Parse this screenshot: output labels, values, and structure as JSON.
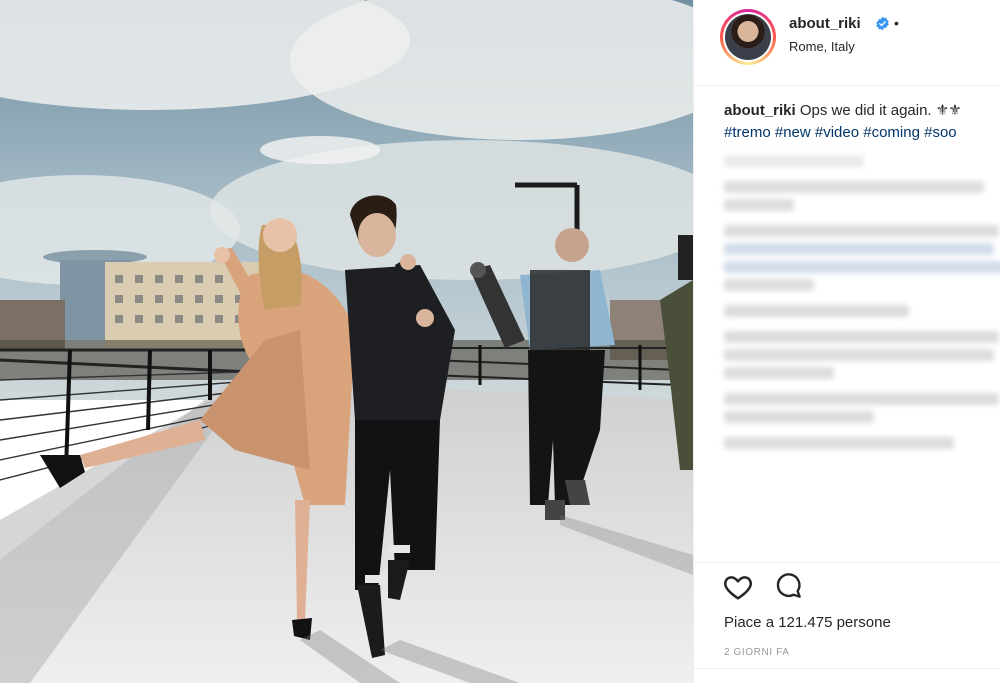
{
  "post": {
    "username": "about_riki",
    "location": "Rome, Italy",
    "separator": "•",
    "caption_text": "Ops we did it again.",
    "caption_emoji": "⚜⚜",
    "hashtags": "#tremo #new #video #coming #soo",
    "load_more": "Carica altri commenti",
    "likes": "Piace a 121.475 persone",
    "time": "2 GIORNI FA"
  },
  "icons": {
    "verified": "verified-badge-icon",
    "like": "heart-icon",
    "comment": "comment-icon"
  },
  "colors": {
    "text": "#262626",
    "hashtag": "#003569",
    "verified": "#3897f0",
    "muted": "#999999",
    "divider": "#efefef"
  }
}
